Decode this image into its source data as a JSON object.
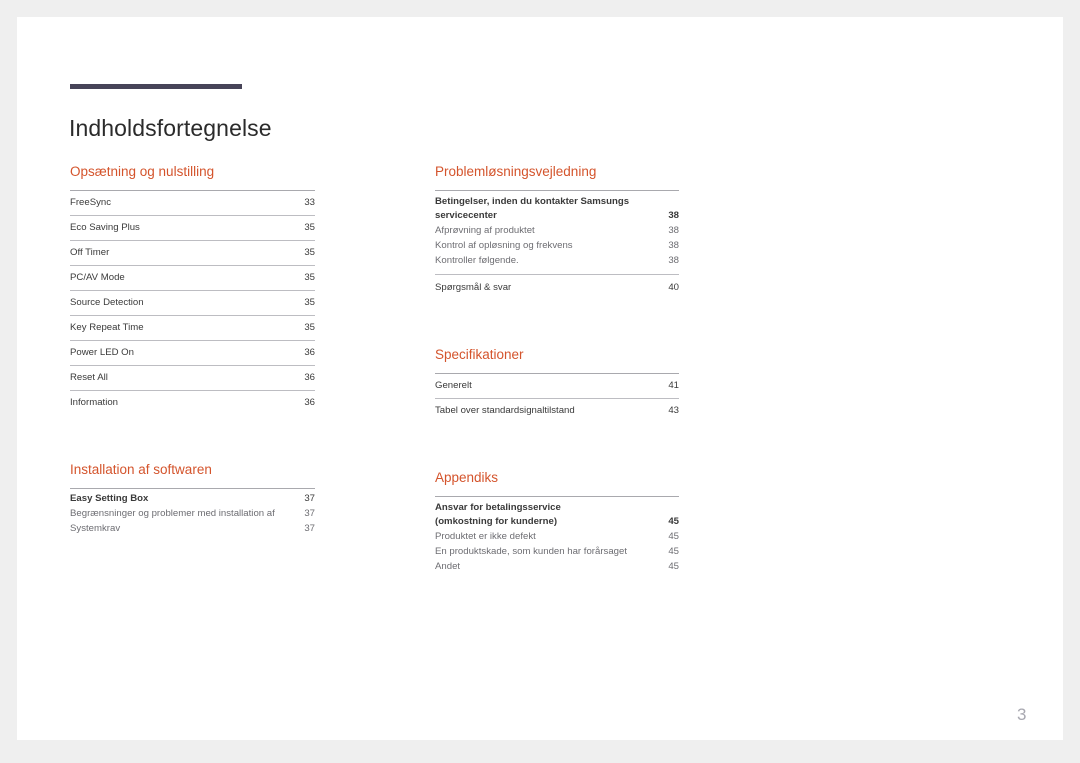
{
  "document": {
    "title": "Indholdsfortegnelse",
    "page_number": "3",
    "accent_color": "#d4542c",
    "rule_color": "#474458"
  },
  "columns": {
    "left": [
      {
        "heading": "Opsætning og nulstilling",
        "style": "ruled",
        "entries": [
          {
            "label": "FreeSync",
            "page": "33"
          },
          {
            "label": "Eco Saving Plus",
            "page": "35"
          },
          {
            "label": "Off Timer",
            "page": "35"
          },
          {
            "label": "PC/AV Mode",
            "page": "35"
          },
          {
            "label": "Source Detection",
            "page": "35"
          },
          {
            "label": "Key Repeat Time",
            "page": "35"
          },
          {
            "label": "Power LED On",
            "page": "36"
          },
          {
            "label": "Reset All",
            "page": "36"
          },
          {
            "label": "Information",
            "page": "36"
          }
        ]
      },
      {
        "heading": "Installation af softwaren",
        "style": "compact",
        "entries": [
          {
            "label": "Easy Setting Box",
            "page": "37",
            "level": "main"
          },
          {
            "label": "Begrænsninger og problemer med installation af",
            "page": "37",
            "level": "sub"
          },
          {
            "label": "Systemkrav",
            "page": "37",
            "level": "sub"
          }
        ]
      }
    ],
    "right": [
      {
        "heading": "Problemløsningsvejledning",
        "style": "compact",
        "entries": [
          {
            "label": "Betingelser, inden du kontakter Samsungs",
            "label2": "servicecenter",
            "page": "38",
            "level": "main-wrap"
          },
          {
            "label": "Afprøvning af produktet",
            "page": "38",
            "level": "sub"
          },
          {
            "label": "Kontrol af opløsning og frekvens",
            "page": "38",
            "level": "sub"
          },
          {
            "label": "Kontroller følgende.",
            "page": "38",
            "level": "sub"
          },
          {
            "label": "Spørgsmål & svar",
            "page": "40",
            "level": "main-ruled"
          }
        ]
      },
      {
        "heading": "Specifikationer",
        "style": "ruled",
        "entries": [
          {
            "label": "Generelt",
            "page": "41"
          },
          {
            "label": "Tabel over standardsignaltilstand",
            "page": "43"
          }
        ]
      },
      {
        "heading": "Appendiks",
        "style": "compact",
        "entries": [
          {
            "label": "Ansvar for betalingsservice",
            "label2": "(omkostning for kunderne)",
            "page": "45",
            "level": "main-wrap"
          },
          {
            "label": "Produktet er ikke defekt",
            "page": "45",
            "level": "sub"
          },
          {
            "label": "En produktskade, som kunden har forårsaget",
            "page": "45",
            "level": "sub"
          },
          {
            "label": "Andet",
            "page": "45",
            "level": "sub"
          }
        ]
      }
    ]
  }
}
